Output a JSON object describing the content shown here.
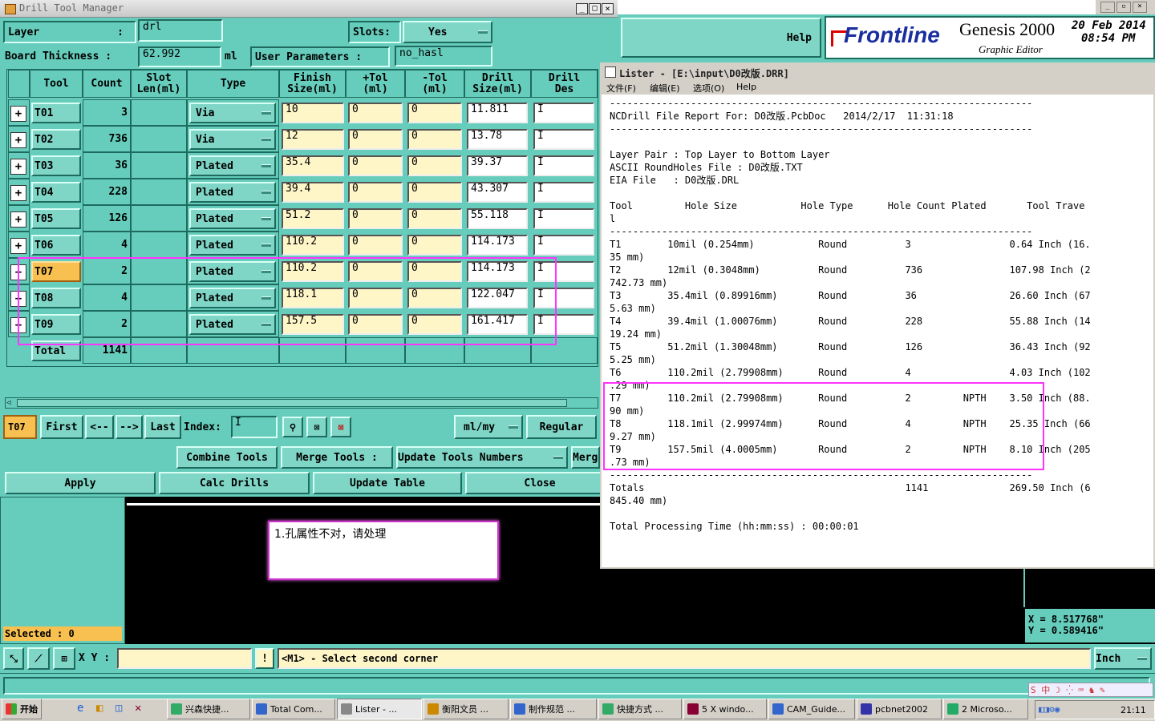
{
  "colors": {
    "teal": "#66ccbb",
    "field": "#fff6c8",
    "highlight": "#ff33ff",
    "selected_tool": "#f8c050"
  },
  "drill_window": {
    "title": "Drill Tool Manager",
    "layer_label": "Layer",
    "layer_colon": ":",
    "layer_value": "drl",
    "slots_label": "Slots:",
    "slots_value": "Yes",
    "board_thickness_label": "Board Thickness :",
    "board_thickness_value": "62.992",
    "board_thickness_unit": "ml",
    "user_params_label": "User Parameters :",
    "user_params_value": "no_hasl",
    "columns": [
      "Tool",
      "Count",
      "Slot\nLen(ml)",
      "Type",
      "Finish\nSize(ml)",
      "+Tol\n(ml)",
      "-Tol\n(ml)",
      "Drill\nSize(ml)",
      "Drill\nDes"
    ],
    "rows": [
      {
        "tool": "T01",
        "count": "3",
        "type": "Via",
        "finish": "10",
        "ptol": "0",
        "mtol": "0",
        "drill": "11.811"
      },
      {
        "tool": "T02",
        "count": "736",
        "type": "Via",
        "finish": "12",
        "ptol": "0",
        "mtol": "0",
        "drill": "13.78"
      },
      {
        "tool": "T03",
        "count": "36",
        "type": "Plated",
        "finish": "35.4",
        "ptol": "0",
        "mtol": "0",
        "drill": "39.37"
      },
      {
        "tool": "T04",
        "count": "228",
        "type": "Plated",
        "finish": "39.4",
        "ptol": "0",
        "mtol": "0",
        "drill": "43.307"
      },
      {
        "tool": "T05",
        "count": "126",
        "type": "Plated",
        "finish": "51.2",
        "ptol": "0",
        "mtol": "0",
        "drill": "55.118"
      },
      {
        "tool": "T06",
        "count": "4",
        "type": "Plated",
        "finish": "110.2",
        "ptol": "0",
        "mtol": "0",
        "drill": "114.173"
      },
      {
        "tool": "T07",
        "count": "2",
        "type": "Plated",
        "finish": "110.2",
        "ptol": "0",
        "mtol": "0",
        "drill": "114.173"
      },
      {
        "tool": "T08",
        "count": "4",
        "type": "Plated",
        "finish": "118.1",
        "ptol": "0",
        "mtol": "0",
        "drill": "122.047"
      },
      {
        "tool": "T09",
        "count": "2",
        "type": "Plated",
        "finish": "157.5",
        "ptol": "0",
        "mtol": "0",
        "drill": "161.417"
      }
    ],
    "total_label": "Total",
    "total_count": "1141",
    "current_tool": "T07",
    "nav": {
      "first": "First",
      "prev": "<--",
      "next": "-->",
      "last": "Last",
      "index_label": "Index:"
    },
    "units_value": "ml/my",
    "regular_label": "Regular",
    "combine": "Combine Tools",
    "merge": "Merge Tools :",
    "update_numbers": "Update Tools Numbers",
    "merge_more": "Merge",
    "apply": "Apply",
    "calc": "Calc Drills",
    "update_table": "Update Table",
    "close": "Close"
  },
  "genesis": {
    "help": "Help",
    "brand": "Frontline",
    "product": "Genesis 2000",
    "subtitle": "Graphic Editor",
    "date": "20 Feb 2014",
    "time": "08:54 PM"
  },
  "lister": {
    "title": "Lister - [E:\\input\\D0改版.DRR]",
    "menu": [
      "文件(F)",
      "编辑(E)",
      "选项(O)",
      "Help"
    ],
    "lines": [
      "-------------------------------------------------------------------------",
      "NCDrill File Report For: D0改版.PcbDoc   2014/2/17  11:31:18",
      "-------------------------------------------------------------------------",
      "",
      "Layer Pair : Top Layer to Bottom Layer",
      "ASCII RoundHoles File : D0改版.TXT",
      "EIA File   : D0改版.DRL",
      "",
      "Tool         Hole Size           Hole Type      Hole Count Plated       Tool Trave",
      "l",
      "-------------------------------------------------------------------------",
      "T1        10mil (0.254mm)           Round          3                 0.64 Inch (16.",
      "35 mm)",
      "T2        12mil (0.3048mm)          Round          736               107.98 Inch (2",
      "742.73 mm)",
      "T3        35.4mil (0.89916mm)       Round          36                26.60 Inch (67",
      "5.63 mm)",
      "T4        39.4mil (1.00076mm)       Round          228               55.88 Inch (14",
      "19.24 mm)",
      "T5        51.2mil (1.30048mm)       Round          126               36.43 Inch (92",
      "5.25 mm)",
      "T6        110.2mil (2.79908mm)      Round          4                 4.03 Inch (102",
      ".29 mm)",
      "T7        110.2mil (2.79908mm)      Round          2         NPTH    3.50 Inch (88.",
      "90 mm)",
      "T8        118.1mil (2.99974mm)      Round          4         NPTH    25.35 Inch (66",
      "9.27 mm)",
      "T9        157.5mil (4.0005mm)       Round          2         NPTH    8.10 Inch (205",
      ".73 mm)",
      "-------------------------------------------------------------------------",
      "Totals                                             1141              269.50 Inch (6",
      "845.40 mm)",
      "",
      "Total Processing Time (hh:mm:ss) : 00:00:01"
    ]
  },
  "note": "1.孔属性不对，请处理",
  "selected": "Selected : 0",
  "coords": {
    "x": "X = 8.517768\"",
    "y": "Y = 0.589416\""
  },
  "status": {
    "xy_label": "X Y :",
    "message": "<M1> - Select second corner",
    "units": "Inch"
  },
  "taskbar": {
    "start": "开始",
    "items": [
      "兴森快捷...",
      "Total Com...",
      "Lister - ...",
      "衡阳文员 ...",
      "制作规范 ...",
      "快捷方式 ...",
      "5 X windo...",
      "CAM_Guide...",
      "pcbnet2002",
      "2 Microso..."
    ],
    "clock": "21:11"
  }
}
